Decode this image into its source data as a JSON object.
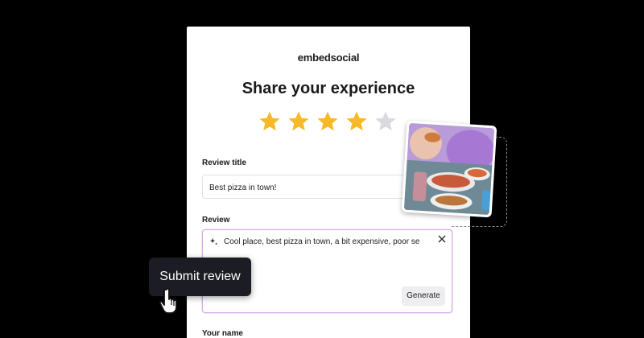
{
  "brand": {
    "logo_text": "embedsocial"
  },
  "form": {
    "title": "Share your experience",
    "rating": {
      "value": 4,
      "max": 5,
      "filled_color": "#F7B928",
      "empty_color": "#D9DADF"
    },
    "review_title": {
      "label": "Review title",
      "value": "Best pizza in town!"
    },
    "review": {
      "label": "Review",
      "value": "Cool place, best pizza in town, a bit expensive, poor se",
      "icons": [
        "sparkle-icon",
        "close-icon"
      ],
      "generate_label": "Generate"
    },
    "name": {
      "label": "Your name"
    }
  },
  "overlay": {
    "submit_tooltip": "Submit review",
    "cursor": "hand-pointer-icon"
  },
  "colors": {
    "accent_border": "#D8A8E8",
    "tooltip_bg": "#1C1D24"
  }
}
